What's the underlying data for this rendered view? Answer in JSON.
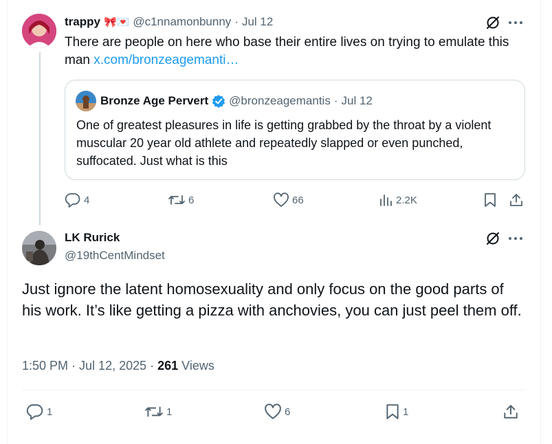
{
  "parent_tweet": {
    "author_name": "trappy",
    "author_emoji": "🎀💌",
    "handle": "@c1nnamonbunny",
    "date": "Jul 12",
    "separator": "·",
    "text": "There are people on here who base their entire lives on trying to emulate this man",
    "link_text": "x.com/bronzeagemanti…",
    "quote": {
      "author_name": "Bronze Age Pervert",
      "handle": "@bronzeagemantis",
      "date": "Jul 12",
      "text": "One of greatest pleasures in life is getting grabbed by the throat by a violent muscular 20 year old athlete and repeatedly slapped or even punched, suffocated. Just what is this"
    },
    "actions": {
      "replies": "4",
      "reposts": "6",
      "likes": "66",
      "views": "2.2K"
    }
  },
  "main_tweet": {
    "author_name": "LK Rurick",
    "handle": "@19thCentMindset",
    "text": "Just ignore the latent homosexuality and only focus on the good parts of his work. It’s like getting a pizza with anchovies, you can just peel them off.",
    "time": "1:50 PM",
    "date": "Jul 12, 2025",
    "separator": "·",
    "views_count": "261",
    "views_label": "Views",
    "actions": {
      "replies": "1",
      "reposts": "1",
      "likes": "6",
      "bookmarks": "1"
    }
  },
  "colors": {
    "accent": "#1d9bf0",
    "muted": "#536471",
    "border": "#cfd9de",
    "text": "#0f1419"
  }
}
